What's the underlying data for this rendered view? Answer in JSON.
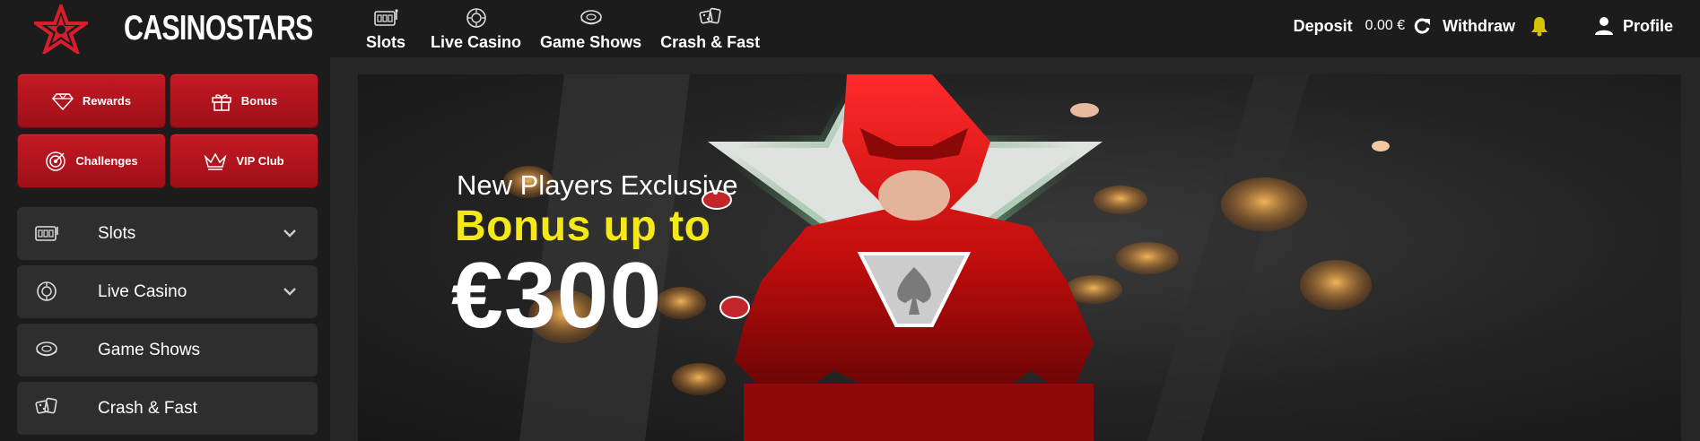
{
  "brand": {
    "name": "CASINOSTARS",
    "logo_icon": "star-logo-icon",
    "accent": "#d81e2a"
  },
  "nav": [
    {
      "label": "Slots",
      "icon": "slot-machine-icon"
    },
    {
      "label": "Live Casino",
      "icon": "roulette-chip-icon"
    },
    {
      "label": "Game Shows",
      "icon": "game-show-wheel-icon"
    },
    {
      "label": "Crash & Fast",
      "icon": "dice-cards-icon"
    }
  ],
  "account": {
    "deposit_label": "Deposit",
    "balance": "0.00 €",
    "refresh_icon": "refresh-icon",
    "withdraw_label": "Withdraw",
    "bell_icon": "bell-icon",
    "bell_color": "#d4c400",
    "profile_label": "Profile",
    "profile_icon": "user-icon"
  },
  "quick_buttons": [
    {
      "label": "Rewards",
      "icon": "diamond-icon"
    },
    {
      "label": "Bonus",
      "icon": "gift-icon"
    },
    {
      "label": "Challenges",
      "icon": "target-icon"
    },
    {
      "label": "VIP Club",
      "icon": "crown-icon"
    }
  ],
  "sidebar_items": [
    {
      "label": "Slots",
      "icon": "slot-machine-icon",
      "expandable": true
    },
    {
      "label": "Live Casino",
      "icon": "roulette-chip-icon",
      "expandable": true
    },
    {
      "label": "Game Shows",
      "icon": "game-show-wheel-icon",
      "expandable": false
    },
    {
      "label": "Crash & Fast",
      "icon": "dice-cards-icon",
      "expandable": false
    }
  ],
  "banner": {
    "line1": "New Players Exclusive",
    "line2": "Bonus up to",
    "amount": "€300",
    "highlight_color": "#f5e81a"
  }
}
